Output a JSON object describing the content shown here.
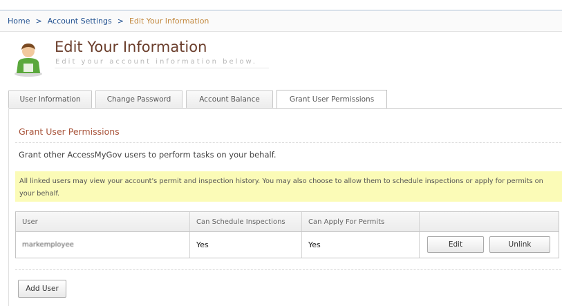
{
  "breadcrumb": {
    "home": "Home",
    "separator": ">",
    "account_settings": "Account Settings",
    "current": "Edit Your Information"
  },
  "header": {
    "icon": "user-profile-icon",
    "title": "Edit Your Information",
    "subtitle": "Edit your account information below."
  },
  "tabs": [
    {
      "label": "User Information",
      "active": false
    },
    {
      "label": "Change Password",
      "active": false
    },
    {
      "label": "Account Balance",
      "active": false
    },
    {
      "label": "Grant User Permissions",
      "active": true
    }
  ],
  "section": {
    "title": "Grant User Permissions",
    "description": "Grant other AccessMyGov users to perform tasks on your behalf.",
    "notice": "All linked users may view your account's permit and inspection history. You may also choose to allow them to schedule inspections or apply for permits on your behalf."
  },
  "table": {
    "columns": [
      "User",
      "Can Schedule Inspections",
      "Can Apply For Permits",
      ""
    ],
    "rows": [
      {
        "user": "markemployee",
        "can_schedule": "Yes",
        "can_apply": "Yes",
        "edit_label": "Edit",
        "unlink_label": "Unlink"
      }
    ]
  },
  "actions": {
    "add_user_label": "Add User"
  },
  "colors": {
    "title": "#6b3e2c",
    "section_title": "#a8533a",
    "breadcrumb_link": "#1f4f8f",
    "breadcrumb_current": "#c2883e",
    "notice_background": "#fbfbb7"
  }
}
